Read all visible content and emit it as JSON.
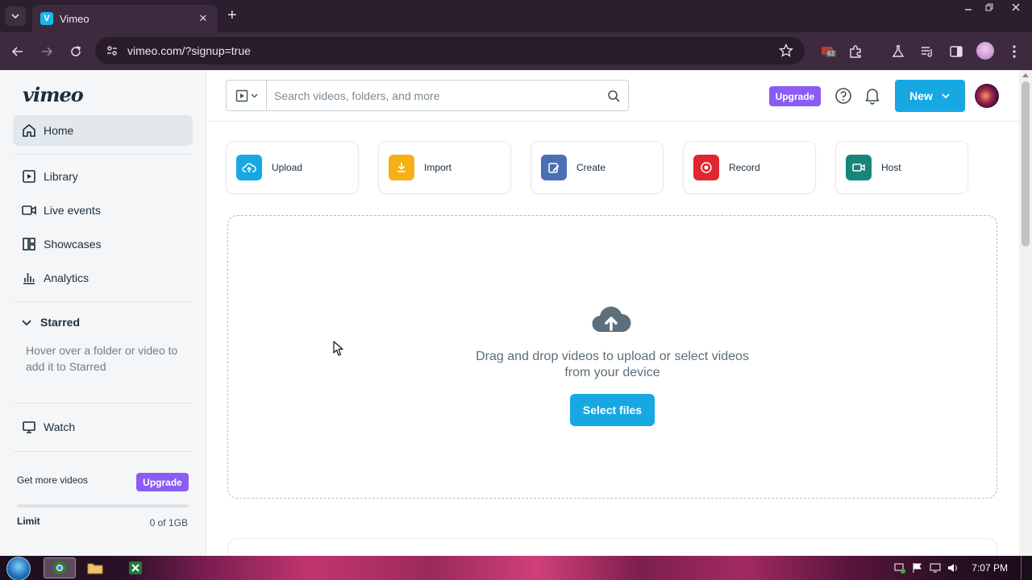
{
  "browser": {
    "tab_title": "Vimeo",
    "tab_favicon_letter": "V",
    "url": "vimeo.com/?signup=true",
    "extension_badge": "63"
  },
  "sidebar": {
    "logo": "vimeo",
    "items": [
      {
        "label": "Home",
        "icon": "home-icon",
        "active": true
      },
      {
        "label": "Library",
        "icon": "library-icon"
      },
      {
        "label": "Live events",
        "icon": "video-camera-icon"
      },
      {
        "label": "Showcases",
        "icon": "showcases-icon"
      },
      {
        "label": "Analytics",
        "icon": "analytics-icon"
      }
    ],
    "starred_title": "Starred",
    "starred_hint": "Hover over a folder or video to add it to Starred",
    "watch_label": "Watch",
    "get_more": "Get more videos",
    "upgrade_label": "Upgrade",
    "limit_label": "Limit",
    "limit_value": "0 of 1GB",
    "usage_fraction": 0
  },
  "header": {
    "search_placeholder": "Search videos, folders, and more",
    "upgrade_label": "Upgrade",
    "new_label": "New"
  },
  "actions": [
    {
      "label": "Upload",
      "icon": "upload-cloud-icon",
      "color": "#17a8e4"
    },
    {
      "label": "Import",
      "icon": "import-icon",
      "color": "#f5b015"
    },
    {
      "label": "Create",
      "icon": "create-icon",
      "color": "#4a6fb5"
    },
    {
      "label": "Record",
      "icon": "record-icon",
      "color": "#e0262e"
    },
    {
      "label": "Host",
      "icon": "host-icon",
      "color": "#16857a"
    }
  ],
  "dropzone": {
    "text_line1": "Drag and drop videos to upload or select videos",
    "text_line2": "from your device",
    "button_label": "Select files"
  },
  "taskbar": {
    "clock": "7:07 PM"
  },
  "colors": {
    "accent": "#17a8e4",
    "upgrade": "#8a5cf5"
  }
}
